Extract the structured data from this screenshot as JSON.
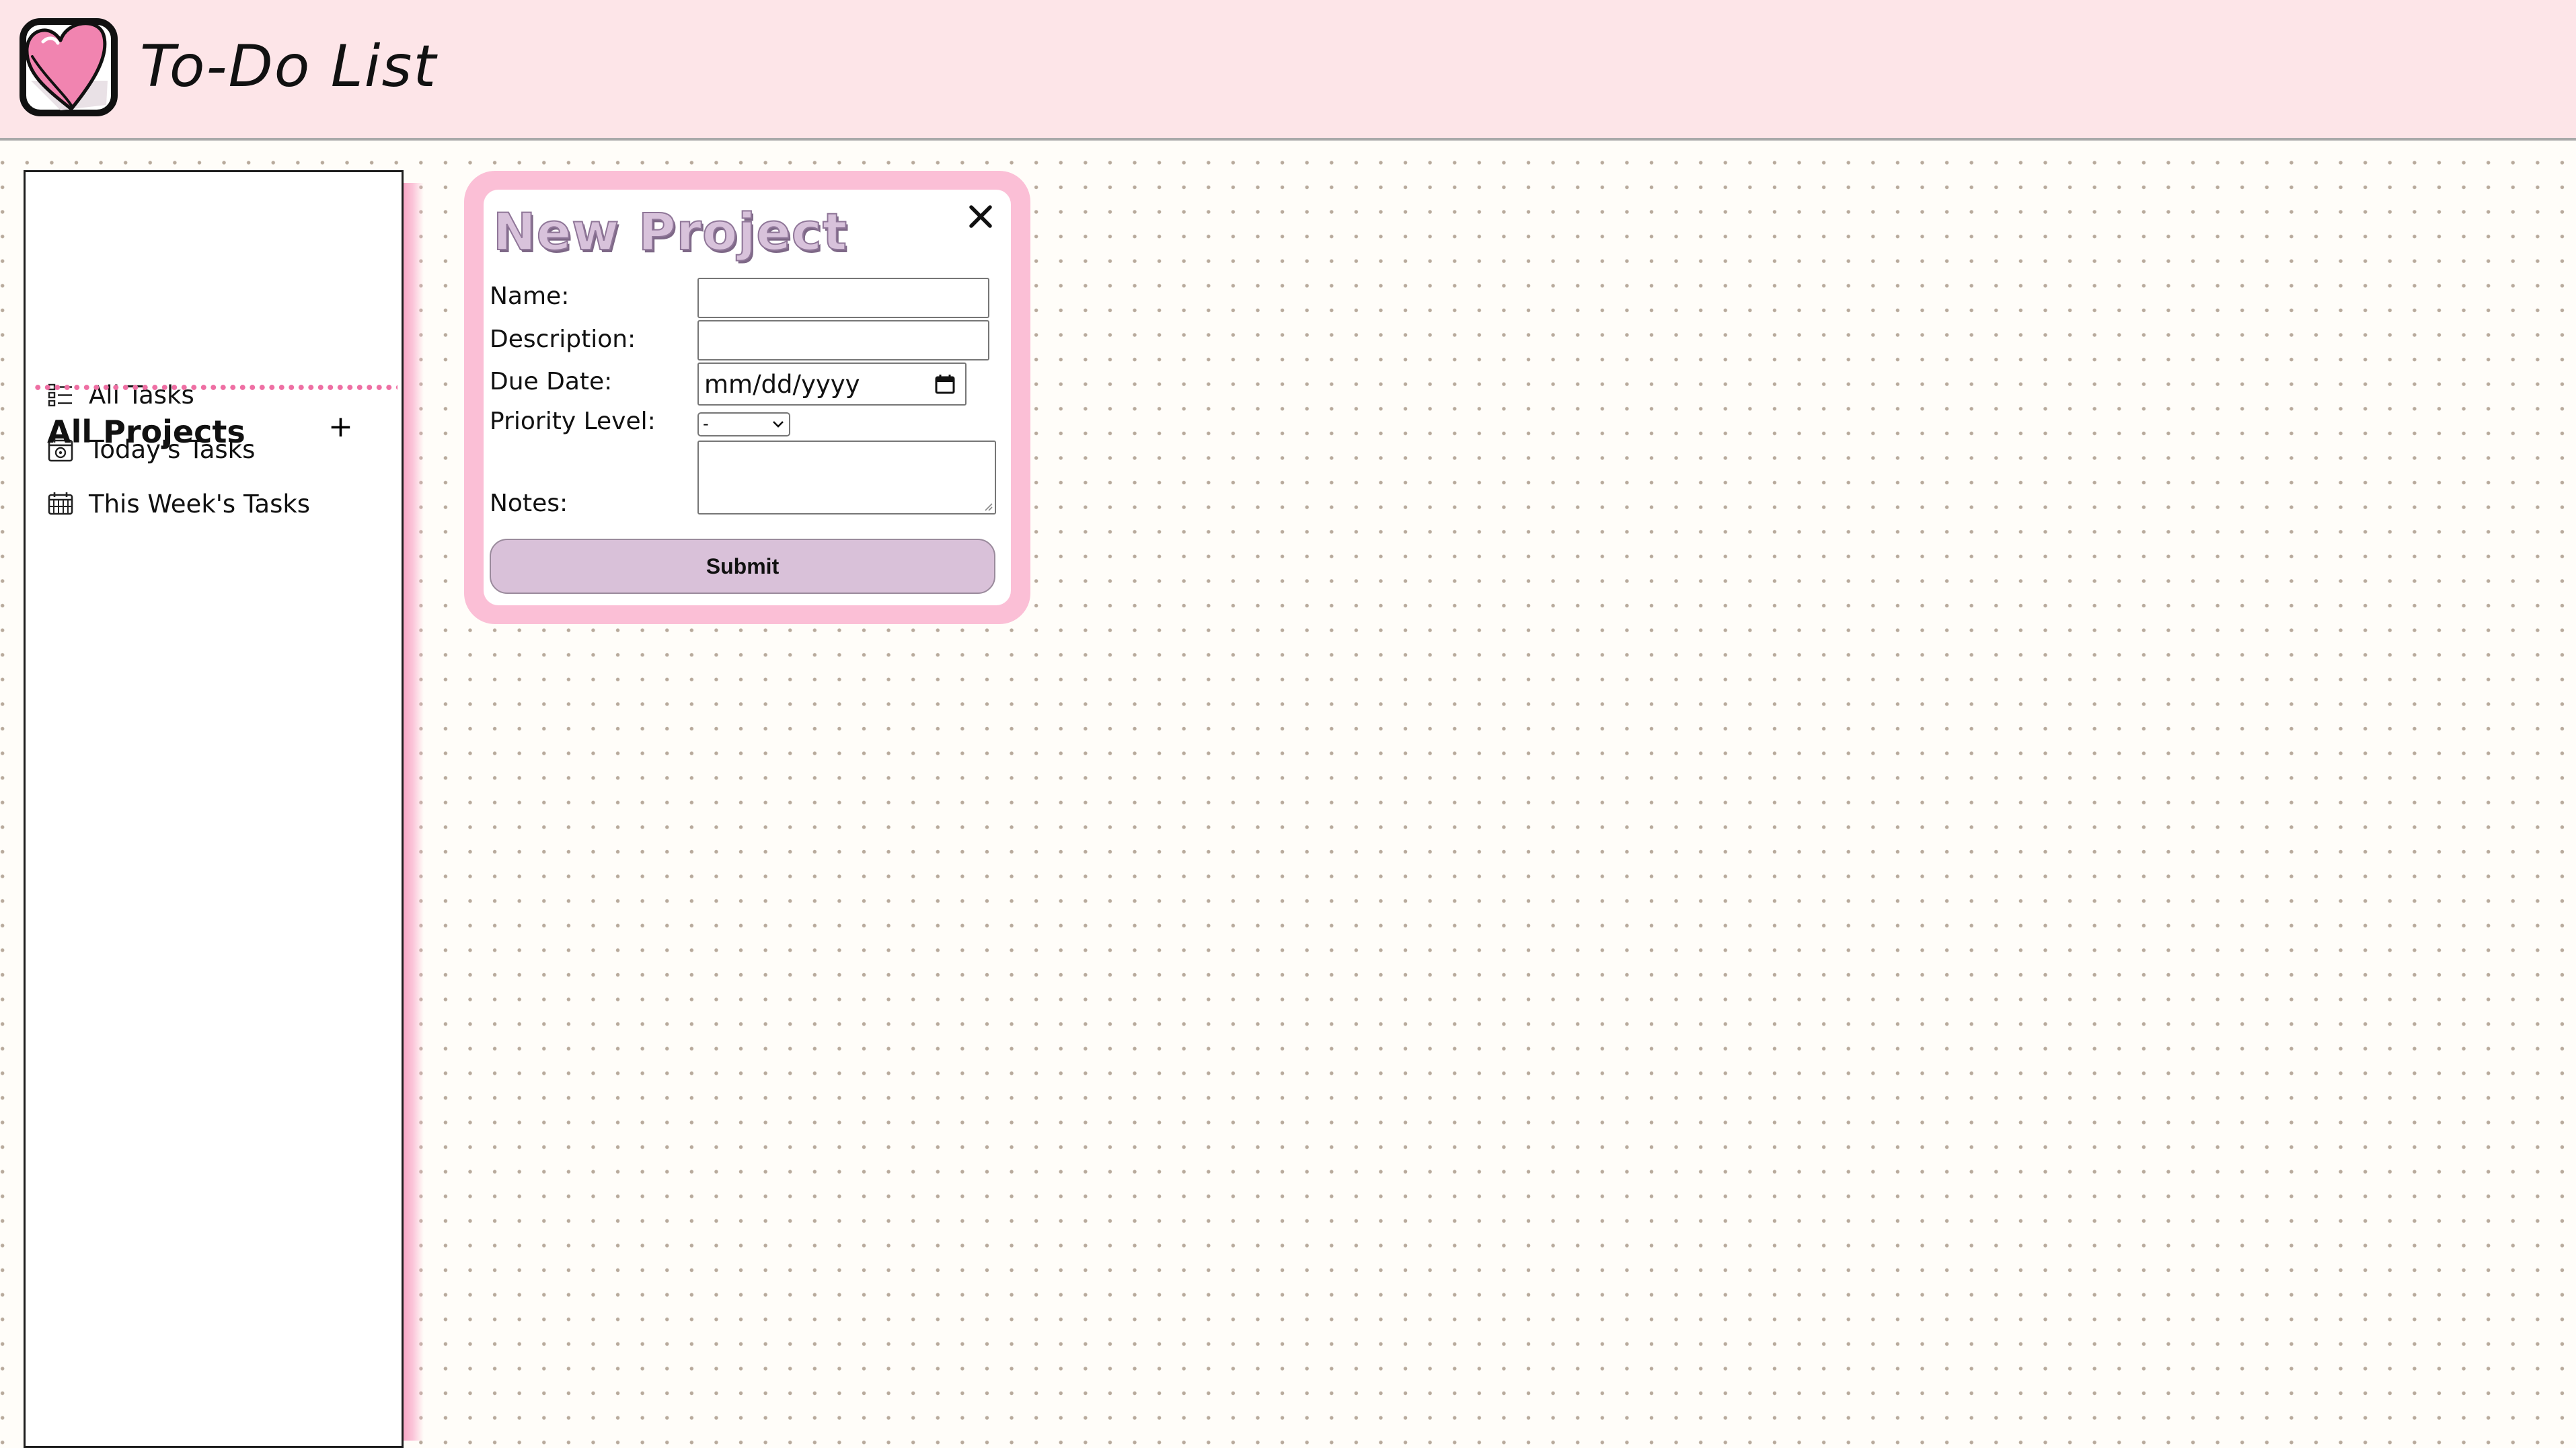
{
  "header": {
    "app_title": "To-Do List",
    "logo_icon": "heart-checkbox-icon",
    "background_color": "#fde5e8"
  },
  "sidebar": {
    "items": [
      {
        "label": "All Tasks",
        "icon": "list-icon"
      },
      {
        "label": "Today's Tasks",
        "icon": "calendar-day-icon"
      },
      {
        "label": "This Week's Tasks",
        "icon": "calendar-week-icon"
      }
    ],
    "projects_heading": "All Projects",
    "add_project_label": "+",
    "divider_color": "#ee6fa3"
  },
  "modal": {
    "title": "New Project",
    "close_icon": "close-icon",
    "frame_color": "#fbbfd6",
    "fields": {
      "name_label": "Name:",
      "name_value": "",
      "description_label": "Description:",
      "description_value": "",
      "due_date_label": "Due Date:",
      "due_date_placeholder": "mm/dd/yyyy",
      "priority_label": "Priority Level:",
      "priority_selected": "-",
      "notes_label": "Notes:",
      "notes_value": ""
    },
    "submit_label": "Submit",
    "submit_color": "#d9c1d9"
  }
}
